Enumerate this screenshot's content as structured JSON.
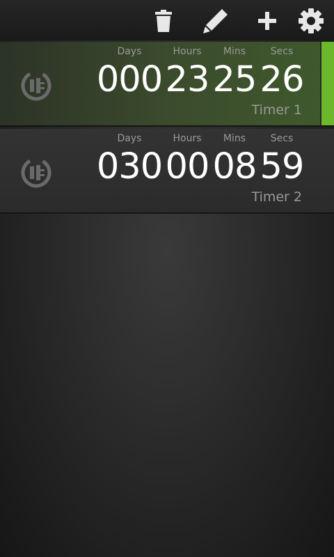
{
  "actionbar": {
    "icons": [
      "trash-icon",
      "pencil-icon",
      "plus-icon",
      "gear-icon"
    ]
  },
  "colors": {
    "accent": "#6cb82c",
    "active_row": "#3b4b2d"
  },
  "timers": [
    {
      "name": "Timer 1",
      "active": true,
      "labels": {
        "days": "Days",
        "hours": "Hours",
        "mins": "Mins",
        "secs": "Secs"
      },
      "values": {
        "days": "000",
        "hours": "23",
        "mins": "25",
        "secs": "26"
      }
    },
    {
      "name": "Timer 2",
      "active": false,
      "labels": {
        "days": "Days",
        "hours": "Hours",
        "mins": "Mins",
        "secs": "Secs"
      },
      "values": {
        "days": "030",
        "hours": "00",
        "mins": "08",
        "secs": "59"
      }
    }
  ]
}
